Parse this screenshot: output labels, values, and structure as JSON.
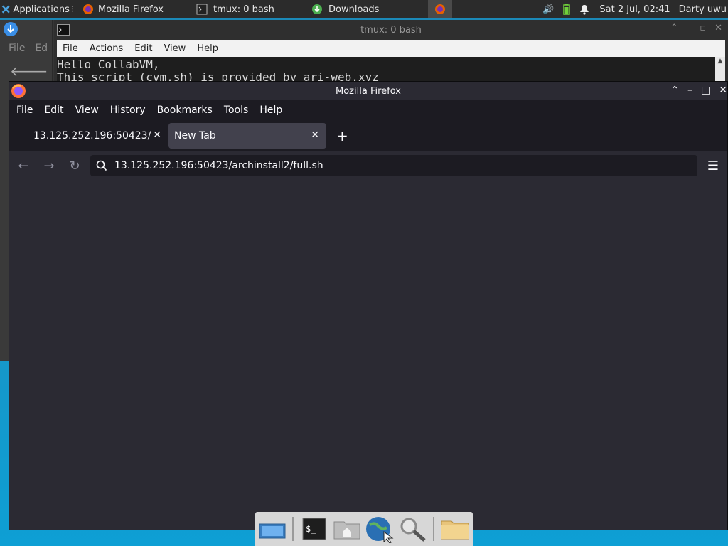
{
  "top_panel": {
    "applications_label": "Applications",
    "tasks": [
      {
        "label": "Mozilla Firefox",
        "icon": "firefox-icon"
      },
      {
        "label": "tmux: 0 bash",
        "icon": "terminal-icon"
      },
      {
        "label": "Downloads",
        "icon": "download-icon"
      }
    ],
    "clock": "Sat  2 Jul, 02:41",
    "user": "Darty uwu"
  },
  "bg_window": {
    "menu_file": "File",
    "menu_edit_partial": "Ed"
  },
  "tmux_window": {
    "title": "tmux: 0 bash",
    "menu": [
      "File",
      "Actions",
      "Edit",
      "View",
      "Help"
    ],
    "terminal_lines": [
      "Hello CollabVM,",
      "This script (cvm.sh) is provided by ari-web.xyz"
    ]
  },
  "firefox": {
    "title": "Mozilla Firefox",
    "menu": [
      "File",
      "Edit",
      "View",
      "History",
      "Bookmarks",
      "Tools",
      "Help"
    ],
    "tabs": [
      {
        "label": "13.125.252.196:50423/",
        "selected": false
      },
      {
        "label": "New Tab",
        "selected": true
      }
    ],
    "new_tab_label": "+",
    "url": "13.125.252.196:50423/archinstall2/full.sh"
  },
  "colors": {
    "firefox_bg": "#2b2a33",
    "panel_bg": "#2b2b2b",
    "desktop": "#1796c8"
  },
  "dock": {
    "items": [
      "desktop-icon",
      "terminal-icon",
      "home-folder-icon",
      "web-browser-icon",
      "search-icon",
      "folder-icon"
    ]
  }
}
